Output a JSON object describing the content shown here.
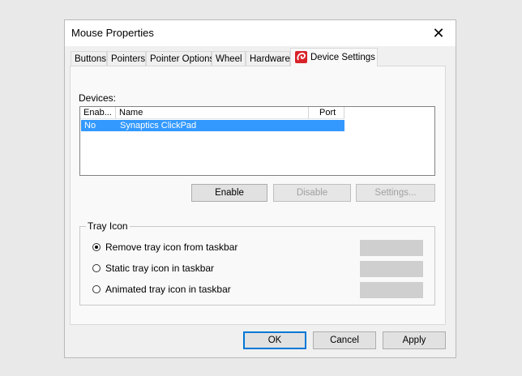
{
  "window": {
    "title": "Mouse Properties",
    "close_glyph": "✕"
  },
  "tabs": [
    "Buttons",
    "Pointers",
    "Pointer Options",
    "Wheel",
    "Hardware",
    "Device Settings"
  ],
  "active_tab": "Device Settings",
  "devices": {
    "label": "Devices:",
    "columns": [
      "Enab...",
      "Name",
      "Port"
    ],
    "rows": [
      {
        "enabled": "No",
        "name": "Synaptics ClickPad",
        "port": ""
      }
    ]
  },
  "device_buttons": {
    "enable": "Enable",
    "disable": "Disable",
    "settings": "Settings..."
  },
  "tray_icon": {
    "group_label": "Tray Icon",
    "options": [
      "Remove tray icon from taskbar",
      "Static tray icon in taskbar",
      "Animated tray icon in taskbar"
    ],
    "selected_index": 0
  },
  "dialog_buttons": {
    "ok": "OK",
    "cancel": "Cancel",
    "apply": "Apply"
  },
  "colors": {
    "selection": "#3399ff",
    "default_button_border": "#0078d7",
    "synaptics_icon": "#d9232a"
  }
}
